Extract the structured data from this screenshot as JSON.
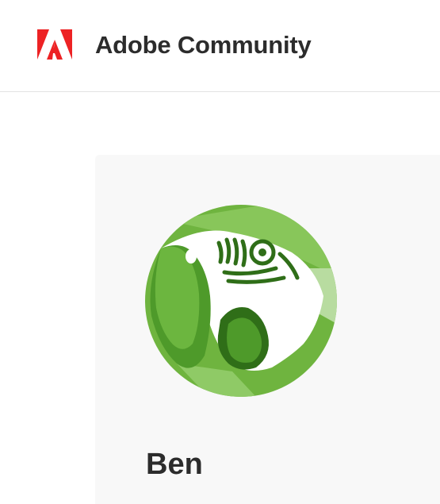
{
  "header": {
    "site_title": "Adobe Community",
    "logo_icon": "adobe-logo-icon",
    "brand_color": "#ED2224"
  },
  "profile": {
    "avatar_icon": "parrot-avatar-icon",
    "display_name": "Ben"
  }
}
